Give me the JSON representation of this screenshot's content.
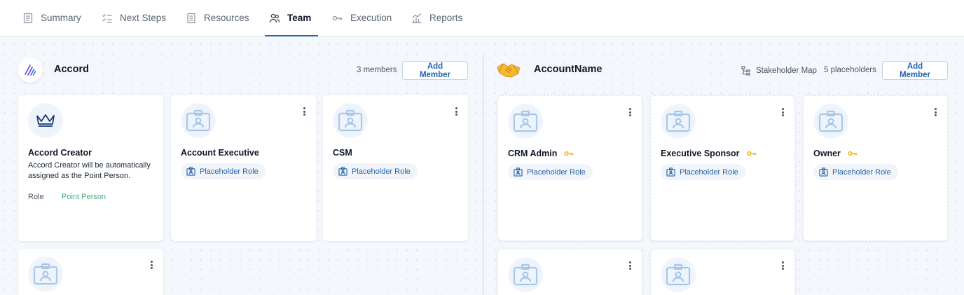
{
  "nav": {
    "tabs": [
      {
        "label": "Summary",
        "icon": "document-icon"
      },
      {
        "label": "Next Steps",
        "icon": "checklist-icon"
      },
      {
        "label": "Resources",
        "icon": "file-icon"
      },
      {
        "label": "Team",
        "icon": "users-icon",
        "active": true
      },
      {
        "label": "Execution",
        "icon": "key-icon"
      },
      {
        "label": "Reports",
        "icon": "chart-icon"
      }
    ]
  },
  "left_panel": {
    "org_name": "Accord",
    "member_count": "3 members",
    "add_button": "Add Member",
    "logo": "accord-logo",
    "cards": [
      {
        "title": "Accord Creator",
        "description": "Accord Creator will be automatically assigned as the Point Person.",
        "role_label": "Role",
        "role_value": "Point Person",
        "icon": "crown-icon"
      },
      {
        "title": "Account Executive",
        "role": "Placeholder Role",
        "icon": "badge-icon"
      },
      {
        "title": "CSM",
        "role": "Placeholder Role",
        "icon": "badge-icon"
      },
      {
        "icon": "badge-icon"
      }
    ]
  },
  "right_panel": {
    "org_name": "AccountName",
    "logo": "handshake-icon",
    "stakeholder_map": "Stakeholder Map",
    "placeholder_count": "5 placeholders",
    "add_button": "Add Member",
    "cards": [
      {
        "title": "CRM Admin",
        "role": "Placeholder Role",
        "key": true
      },
      {
        "title": "Executive Sponsor",
        "role": "Placeholder Role",
        "key": true
      },
      {
        "title": "Owner",
        "role": "Placeholder Role",
        "key": true
      },
      {},
      {}
    ]
  },
  "colors": {
    "accent": "#2563a8",
    "point_person": "#4caf7d",
    "key": "#f2b824",
    "badge_icon": "#a9c8ea"
  }
}
